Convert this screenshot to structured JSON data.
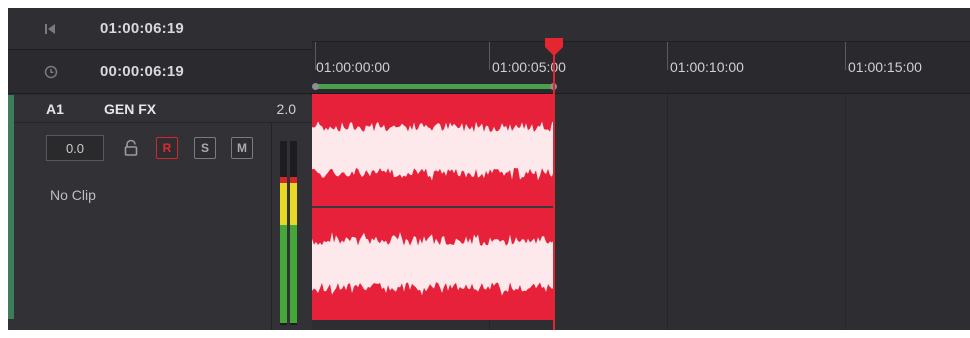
{
  "header": {
    "timecode_current": "01:00:06:19",
    "timecode_duration": "00:00:06:19",
    "icons": {
      "row1": "go-to-start-icon",
      "row2": "clock-icon"
    }
  },
  "track": {
    "id": "A1",
    "name": "GEN FX",
    "channel_format": "2.0",
    "volume": "0.0",
    "buttons": {
      "record": "R",
      "solo": "S",
      "mute": "M"
    },
    "clip_status": "No Clip",
    "accent_color": "#3e7d5a"
  },
  "ruler": {
    "labels": [
      "01:00:00:00",
      "01:00:05:00",
      "01:00:10:00",
      "01:00:15:00"
    ]
  },
  "colors": {
    "clip": "#e8213a",
    "waveform": "#fde9ec",
    "playhead": "#e3262f",
    "range_bar": "#49a04a",
    "meter_red": "#d5262b",
    "meter_yellow": "#e6d825",
    "meter_green": "#45a63a"
  }
}
